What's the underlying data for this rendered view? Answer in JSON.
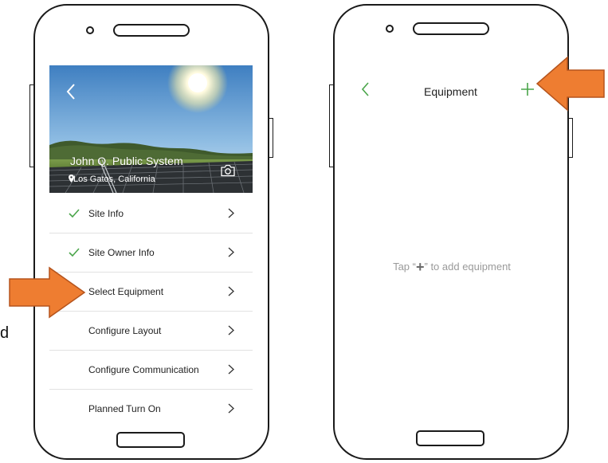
{
  "left_screen": {
    "hero": {
      "title": "John Q. Public System",
      "location": "Los Gatos, California"
    },
    "menu_items": [
      {
        "label": "Site Info",
        "checked": true
      },
      {
        "label": "Site Owner Info",
        "checked": true
      },
      {
        "label": "Select Equipment",
        "checked": false
      },
      {
        "label": "Configure Layout",
        "checked": false
      },
      {
        "label": "Configure Communication",
        "checked": false
      },
      {
        "label": "Planned Turn On",
        "checked": false
      }
    ]
  },
  "right_screen": {
    "nav_title": "Equipment",
    "empty_prefix": "Tap “",
    "empty_plus": "+",
    "empty_suffix": "” to add equipment"
  },
  "stray_glyph": "d",
  "colors": {
    "accent_green": "#4aa54a",
    "arrow_orange": "#ee7d31",
    "arrow_outline": "#b5541d"
  },
  "icons": {
    "back": "chevron-left-icon",
    "check": "check-icon",
    "chevron": "chevron-right-icon",
    "location": "location-pin-icon",
    "camera": "camera-icon",
    "add": "plus-icon"
  }
}
